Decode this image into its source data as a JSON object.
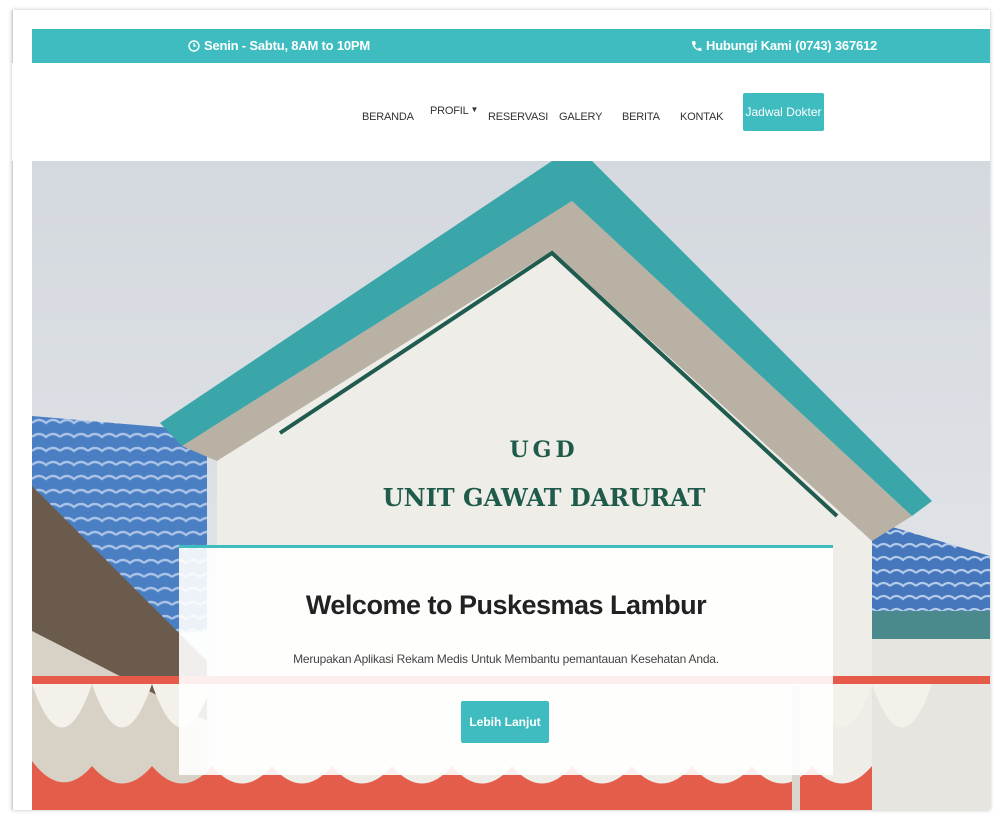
{
  "topbar": {
    "hours": "Senin - Sabtu, 8AM to 10PM",
    "phone": "Hubungi Kami (0743) 367612"
  },
  "nav": {
    "items": [
      "BERANDA",
      "PROFIL",
      "RESERVASI",
      "GALERY",
      "BERITA",
      "KONTAK"
    ],
    "cta": "Jadwal Dokter"
  },
  "hero": {
    "sign_line1": "UGD",
    "sign_line2": "UNIT GAWAT DARURAT",
    "title": "Welcome to Puskesmas Lambur",
    "subtitle": "Merupakan Aplikasi Rekam Medis Untuk Membantu pemantauan Kesehatan Anda.",
    "button": "Lebih Lanjut"
  },
  "colors": {
    "accent": "#3fbcc0",
    "roof_blue": "#4a7fc6",
    "roof_teal": "#2a9ea2"
  }
}
